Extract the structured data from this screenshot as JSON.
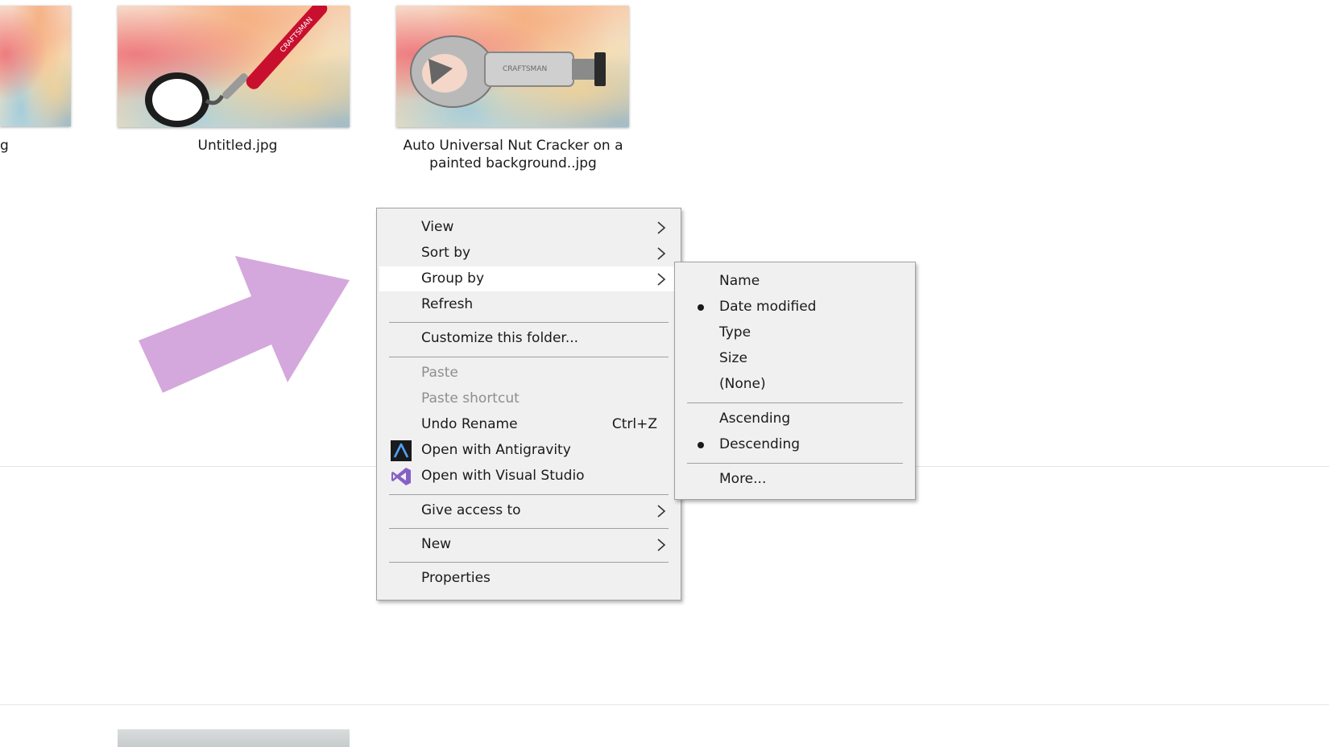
{
  "files": [
    {
      "name": "g"
    },
    {
      "name": "Untitled.jpg"
    },
    {
      "name_line1": "Auto Universal Nut Cracker on a",
      "name_line2": "painted background..jpg"
    }
  ],
  "thumb_text": {
    "magnifier_brand": "CRAFTSMAN",
    "nutcracker_brand": "CRAFTSMAN"
  },
  "colors": {
    "arrow": "#d4a8dc",
    "menu_bg": "#f0f0f0",
    "menu_highlight": "#ffffff",
    "disabled_text": "#8e8e8e"
  },
  "context_menu": {
    "view": "View",
    "sort_by": "Sort by",
    "group_by": "Group by",
    "refresh": "Refresh",
    "customize": "Customize this folder...",
    "paste": "Paste",
    "paste_shortcut": "Paste shortcut",
    "undo_rename": "Undo Rename",
    "undo_shortcut": "Ctrl+Z",
    "open_antigravity": "Open with Antigravity",
    "open_visual_studio": "Open with Visual Studio",
    "give_access": "Give access to",
    "new": "New",
    "properties": "Properties"
  },
  "group_by_submenu": {
    "name": "Name",
    "date_modified": "Date modified",
    "type": "Type",
    "size": "Size",
    "none": "(None)",
    "ascending": "Ascending",
    "descending": "Descending",
    "more": "More...",
    "selected_group": "Date modified",
    "selected_order": "Descending"
  }
}
